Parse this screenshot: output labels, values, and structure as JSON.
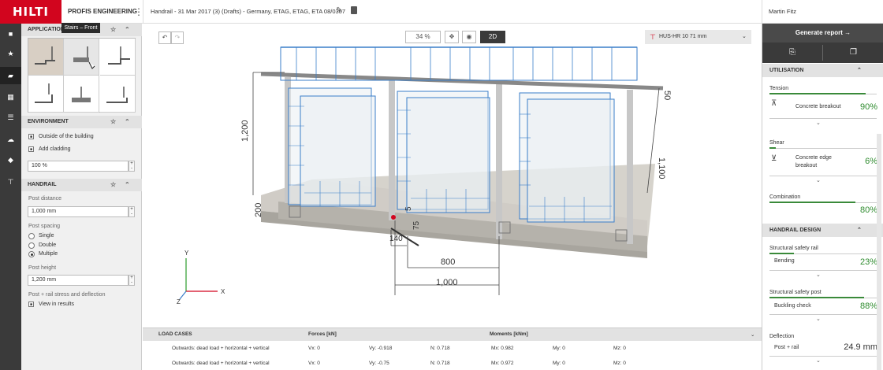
{
  "topbar": {
    "logo": "HILTI",
    "product": "PROFIS ENGINEERING",
    "project": "Handrail - 31 Mar 2017 (3) (Drafts) - Germany, ETAG, ETAG, ETA 08/0307",
    "user": "Martin Fitz"
  },
  "left_nav": {
    "icons": [
      "home-icon",
      "star-icon",
      "ruler-icon",
      "calculator-icon",
      "list-icon",
      "cloud-icon",
      "shield-icon",
      "anchor-icon"
    ]
  },
  "application": {
    "title": "APPLICATION",
    "tooltip": "Stairs – Front"
  },
  "environment": {
    "title": "ENVIRONMENT",
    "outside_label": "Outside of the building",
    "cladding_label": "Add cladding",
    "percent_value": "100 %"
  },
  "handrail": {
    "title": "HANDRAIL",
    "post_distance_label": "Post distance",
    "post_distance_value": "1,000 mm",
    "post_spacing_label": "Post spacing",
    "spacing_options": [
      "Single",
      "Double",
      "Multiple"
    ],
    "spacing_selected": "Multiple",
    "post_height_label": "Post height",
    "post_height_value": "1,200 mm",
    "stress_label": "Post + rail stress and deflection",
    "view_results_label": "View in results"
  },
  "viewport": {
    "zoom": "34 %",
    "mode_2d": "2D",
    "anchor": "HUS-HR 10 71 mm",
    "dimensions": {
      "height_1200": "1,200",
      "height_1100": "1,100",
      "top_50": "50",
      "base_200": "200",
      "d_140": "140",
      "d_75": "75",
      "d_800": "800",
      "d_1000": "1,000",
      "d_5": "5"
    },
    "axes": {
      "x": "X",
      "y": "Y",
      "z": "Z"
    }
  },
  "load_cases": {
    "title": "LOAD CASES",
    "forces_header": "Forces [kN]",
    "moments_header": "Moments [kNm]",
    "rows": [
      {
        "name": "Outwards: dead load + horizontal + vertical",
        "vx": "Vx: 0",
        "vy": "Vy: -0.918",
        "n": "N: 0.718",
        "mx": "Mx: 0.982",
        "my": "My: 0",
        "mz": "Mz: 0"
      },
      {
        "name": "Outwards: dead load + horizontal + vertical",
        "vx": "Vx: 0",
        "vy": "Vy: -0.75",
        "n": "N: 0.718",
        "mx": "Mx: 0.972",
        "my": "My: 0",
        "mz": "Mz: 0"
      }
    ]
  },
  "right": {
    "generate_report": "Generate report",
    "utilisation_title": "UTILISATION",
    "tension_label": "Tension",
    "concrete_breakout_label": "Concrete breakout",
    "concrete_breakout_pct": "90%",
    "concrete_breakout_fill": 0.9,
    "shear_label": "Shear",
    "concrete_edge_label": "Concrete edge breakout",
    "concrete_edge_pct": "6%",
    "concrete_edge_fill": 0.06,
    "combination_label": "Combination",
    "combination_pct": "80%",
    "combination_fill": 0.8,
    "handrail_design_title": "HANDRAIL DESIGN",
    "safety_rail_label": "Structural safety rail",
    "bending_label": "Bending",
    "bending_pct": "23%",
    "bending_fill": 0.23,
    "safety_post_label": "Structural safety post",
    "buckling_label": "Buckling check",
    "buckling_pct": "88%",
    "buckling_fill": 0.88,
    "deflection_label": "Deflection",
    "post_rail_label": "Post + rail",
    "deflection_value": "24.9 mm"
  },
  "colors": {
    "brand": "#d2051e",
    "success": "#2e8b2e",
    "dark": "#3a3a3a"
  }
}
